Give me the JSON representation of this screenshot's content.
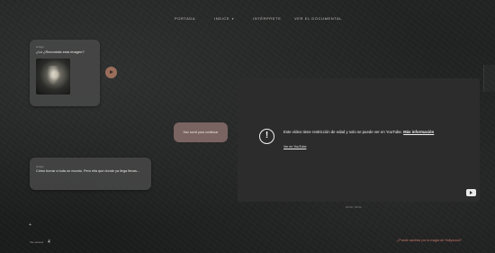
{
  "nav": {
    "items": [
      {
        "label": "Portada"
      },
      {
        "label": "Indice"
      },
      {
        "label": "Intérprete"
      },
      {
        "label": "Ver el documental"
      }
    ]
  },
  "chat": {
    "msg1": {
      "sender": "Amigo",
      "text": "¿Lo ¿Recordáis esta imagen?"
    },
    "reply": {
      "text": "Haz scroll para continuar"
    },
    "msg2": {
      "sender": "Amigo",
      "text": "Cómo borrar a toda un mundo. Pero ella que donde ya llega llevas..."
    }
  },
  "video": {
    "message": "Este vídeo tiene restricción de edad y solo se puede ver en YouTube.",
    "more_label": "Más información",
    "watch_label": "Ver en YouTube",
    "caption": "00:00 / 00:00"
  },
  "footer": {
    "left_label": "Ver escena",
    "left_number": "4",
    "cta": "¿Puede cambiar por la magia de Hollywood?"
  },
  "colors": {
    "accent": "#c7796a",
    "reply_bubble": "#7a6461",
    "play_button": "#9a6e5c"
  },
  "icons": {
    "alert": "alert-circle-icon",
    "youtube": "youtube-logo-icon",
    "play": "play-icon"
  }
}
